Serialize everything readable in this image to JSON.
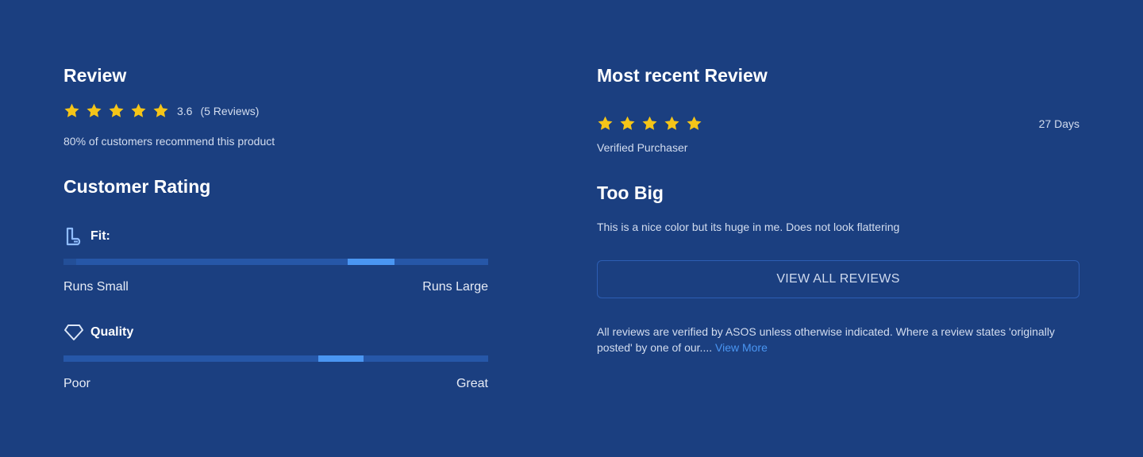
{
  "review": {
    "title": "Review",
    "stars": 5,
    "rating": "3.6",
    "count": "(5 Reviews)",
    "recommend": "80% of customers recommend this product"
  },
  "customer_rating": {
    "title": "Customer Rating",
    "fit": {
      "icon": "fit-icon",
      "label": "Fit:",
      "marker_start_fraction": 0.67,
      "marker_end_fraction": 0.78,
      "min_label": "Runs Small",
      "max_label": "Runs Large"
    },
    "quality": {
      "icon": "diamond-icon",
      "label": "Quality",
      "marker_start_fraction": 0.6,
      "marker_end_fraction": 0.706,
      "min_label": "Poor",
      "max_label": "Great"
    }
  },
  "recent": {
    "title": "Most recent Review",
    "stars": 5,
    "age": "27 Days",
    "verified": "Verified Purchaser",
    "review_title": "Too Big",
    "review_body": "This is a nice color but its huge in me. Does not look flattering",
    "view_all_label": "VIEW ALL REVIEWS"
  },
  "disclaimer": {
    "text": "All reviews are verified by ASOS unless otherwise indicated. Where a review states 'originally posted' by one of our....",
    "link": "View More"
  },
  "colors": {
    "background": "#1b3f80",
    "star": "#f5c518",
    "accent": "#4a96f2",
    "track": "#2657a8"
  }
}
